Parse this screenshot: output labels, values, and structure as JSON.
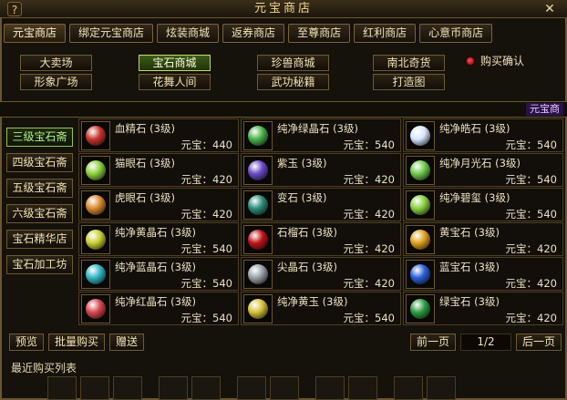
{
  "window": {
    "title": "元宝商店",
    "help": "?",
    "close": "✕"
  },
  "tabs": [
    {
      "label": "元宝商店"
    },
    {
      "label": "绑定元宝商店"
    },
    {
      "label": "炫装商城"
    },
    {
      "label": "返券商店"
    },
    {
      "label": "至尊商店"
    },
    {
      "label": "红利商店"
    },
    {
      "label": "心意币商店"
    }
  ],
  "subtabs": [
    "大卖场",
    "宝石商城",
    "珍兽商城",
    "南北奇货",
    "形象广场",
    "花舞人间",
    "武功秘籍",
    "打造图"
  ],
  "confirm_label": "购买确认",
  "strip_tag": "元宝商",
  "categories": [
    "三级宝石斋",
    "四级宝石斋",
    "五级宝石斋",
    "六级宝石斋",
    "宝石精华店",
    "宝石加工坊"
  ],
  "gems": [
    {
      "name": "血精石 (3级)",
      "price": "元宝：440",
      "color": "#c9352e"
    },
    {
      "name": "纯净绿晶石 (3级)",
      "price": "元宝：540",
      "color": "#4bb34a"
    },
    {
      "name": "纯净皓石 (3级)",
      "price": "元宝：540",
      "color": "#d8e6ff"
    },
    {
      "name": "猫眼石 (3级)",
      "price": "元宝：420",
      "color": "#8cd13b"
    },
    {
      "name": "紫玉 (3级)",
      "price": "元宝：420",
      "color": "#6a4ac9"
    },
    {
      "name": "纯净月光石 (3级)",
      "price": "元宝：540",
      "color": "#71c94c"
    },
    {
      "name": "虎眼石 (3级)",
      "price": "元宝：420",
      "color": "#d98a2e"
    },
    {
      "name": "变石 (3级)",
      "price": "元宝：420",
      "color": "#2d8d7a"
    },
    {
      "name": "纯净碧玺 (3级)",
      "price": "元宝：540",
      "color": "#8ad040"
    },
    {
      "name": "纯净黄晶石 (3级)",
      "price": "元宝：540",
      "color": "#c9d034"
    },
    {
      "name": "石榴石 (3级)",
      "price": "元宝：420",
      "color": "#c1141a"
    },
    {
      "name": "黄宝石 (3级)",
      "price": "元宝：420",
      "color": "#e0a21f"
    },
    {
      "name": "纯净蓝晶石 (3级)",
      "price": "元宝：540",
      "color": "#31b7c5"
    },
    {
      "name": "尖晶石 (3级)",
      "price": "元宝：420",
      "color": "#9aa0a8"
    },
    {
      "name": "蓝宝石 (3级)",
      "price": "元宝：420",
      "color": "#2b5fd9"
    },
    {
      "name": "纯净红晶石 (3级)",
      "price": "元宝：540",
      "color": "#d9474f"
    },
    {
      "name": "纯净黄玉 (3级)",
      "price": "元宝：540",
      "color": "#d6c23a"
    },
    {
      "name": "绿宝石 (3级)",
      "price": "元宝：420",
      "color": "#2e9c41"
    }
  ],
  "bottom_buttons": [
    "预览",
    "批量购买",
    "赠送"
  ],
  "pager": {
    "prev": "前一页",
    "page": "1/2",
    "next": "后一页"
  },
  "recent_label": "最近购买列表"
}
